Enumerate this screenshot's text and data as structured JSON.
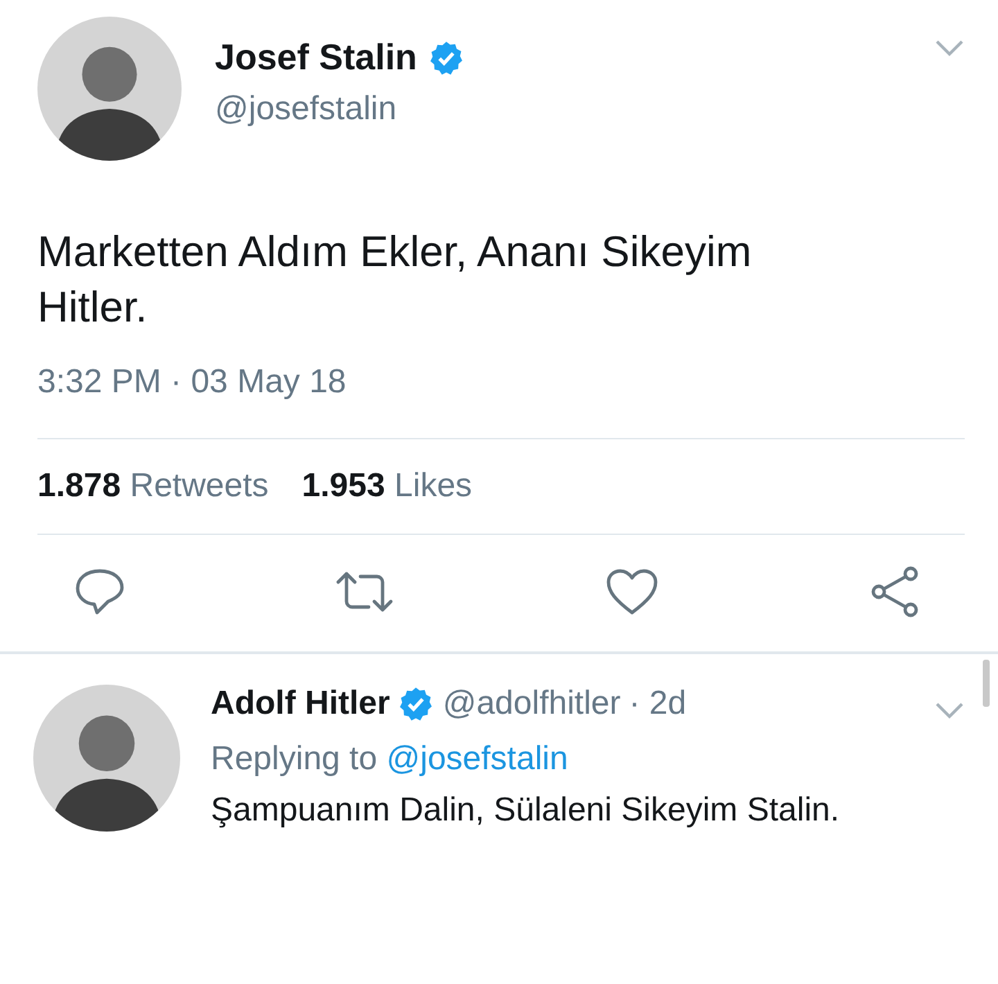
{
  "tweet": {
    "author": {
      "name": "Josef Stalin",
      "handle": "@josefstalin",
      "verified": true
    },
    "text": "Marketten Aldım Ekler, Ananı Sikeyim Hitler.",
    "timestamp": "3:32 PM · 03 May 18",
    "stats": [
      "**1.878** Retweets",
      "**1.953** Likes"
    ],
    "actions": [
      {
        "kind": "reply"
      },
      {
        "kind": "retweet"
      },
      {
        "kind": "like"
      },
      {
        "kind": "share"
      }
    ]
  },
  "reply": {
    "author": {
      "name": "Adolf Hitler",
      "handle": "@adolfhitler",
      "verified": true
    },
    "time": "· 2d",
    "replying_prefix": "Replying to",
    "replying_to": "@josefstalin",
    "text": "Şampuanım Dalin, Sülaleni Sikeyim Stalin."
  }
}
